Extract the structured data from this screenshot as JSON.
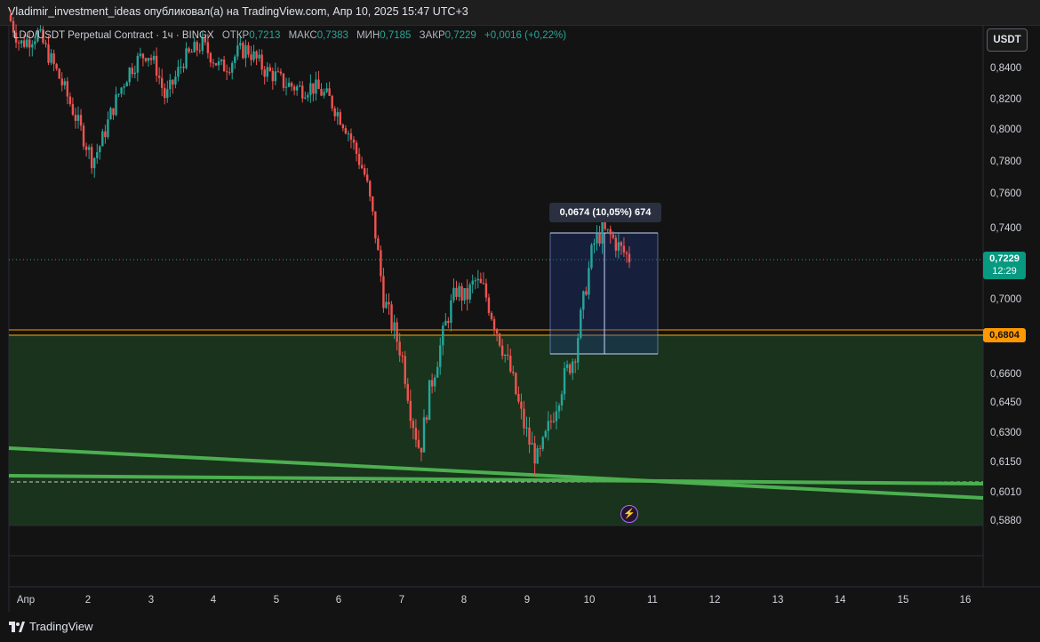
{
  "header": {
    "title": "Vladimir_investment_ideas опубликовал(а) на TradingView.com, Апр 10, 2025 15:47 UTC+3"
  },
  "legend": {
    "symbol": "LDO/USDT Perpetual Contract · 1ч · BINGX",
    "open_label": "ОТКР",
    "open": "0,7213",
    "high_label": "МАКС",
    "high": "0,7383",
    "low_label": "МИН",
    "low": "0,7185",
    "close_label": "ЗАКР",
    "close": "0,7229",
    "change": "+0,0016 (+0,22%)"
  },
  "toolbar": {
    "currency_button": "USDT"
  },
  "price_scale": {
    "ticks": [
      "0,8400",
      "0,8200",
      "0,8000",
      "0,7800",
      "0,7600",
      "0,7400",
      "0,7000",
      "0,6600",
      "0,6450",
      "0,6300",
      "0,6150",
      "0,6010",
      "0,5880"
    ],
    "last_price": "0,7229",
    "countdown": "12:29",
    "line_price": "0,6804"
  },
  "time_scale": {
    "labels": [
      "Апр",
      "2",
      "3",
      "4",
      "5",
      "6",
      "7",
      "8",
      "9",
      "10",
      "11",
      "12",
      "13",
      "14",
      "15",
      "16"
    ]
  },
  "measure_tool": {
    "label": "0,0674 (10,05%) 674"
  },
  "branding": {
    "logo_text": "TradingView"
  },
  "colors": {
    "background": "#131313",
    "up": "#26a69a",
    "down": "#ef5350",
    "trendline": "#4caf50",
    "horizontal_line": "#ff9800",
    "measure_fill": "#2962ff"
  },
  "chart_data": {
    "type": "candlestick",
    "x_axis": "time (April 2025, 1h)",
    "y_range": [
      0.588,
      0.86
    ],
    "last_price": 0.7229,
    "horizontal_level": 0.6804,
    "price_path": [
      0.87,
      0.855,
      0.858,
      0.862,
      0.85,
      0.838,
      0.825,
      0.81,
      0.795,
      0.78,
      0.792,
      0.81,
      0.825,
      0.838,
      0.845,
      0.85,
      0.84,
      0.82,
      0.832,
      0.845,
      0.85,
      0.855,
      0.848,
      0.84,
      0.842,
      0.85,
      0.852,
      0.845,
      0.838,
      0.835,
      0.83,
      0.828,
      0.826,
      0.828,
      0.825,
      0.82,
      0.81,
      0.8,
      0.785,
      0.77,
      0.74,
      0.7,
      0.685,
      0.67,
      0.64,
      0.62,
      0.65,
      0.67,
      0.69,
      0.705,
      0.7,
      0.71,
      0.705,
      0.69,
      0.675,
      0.66,
      0.64,
      0.625,
      0.615,
      0.63,
      0.645,
      0.66,
      0.67,
      0.7,
      0.73,
      0.738,
      0.735,
      0.728,
      0.723
    ]
  }
}
